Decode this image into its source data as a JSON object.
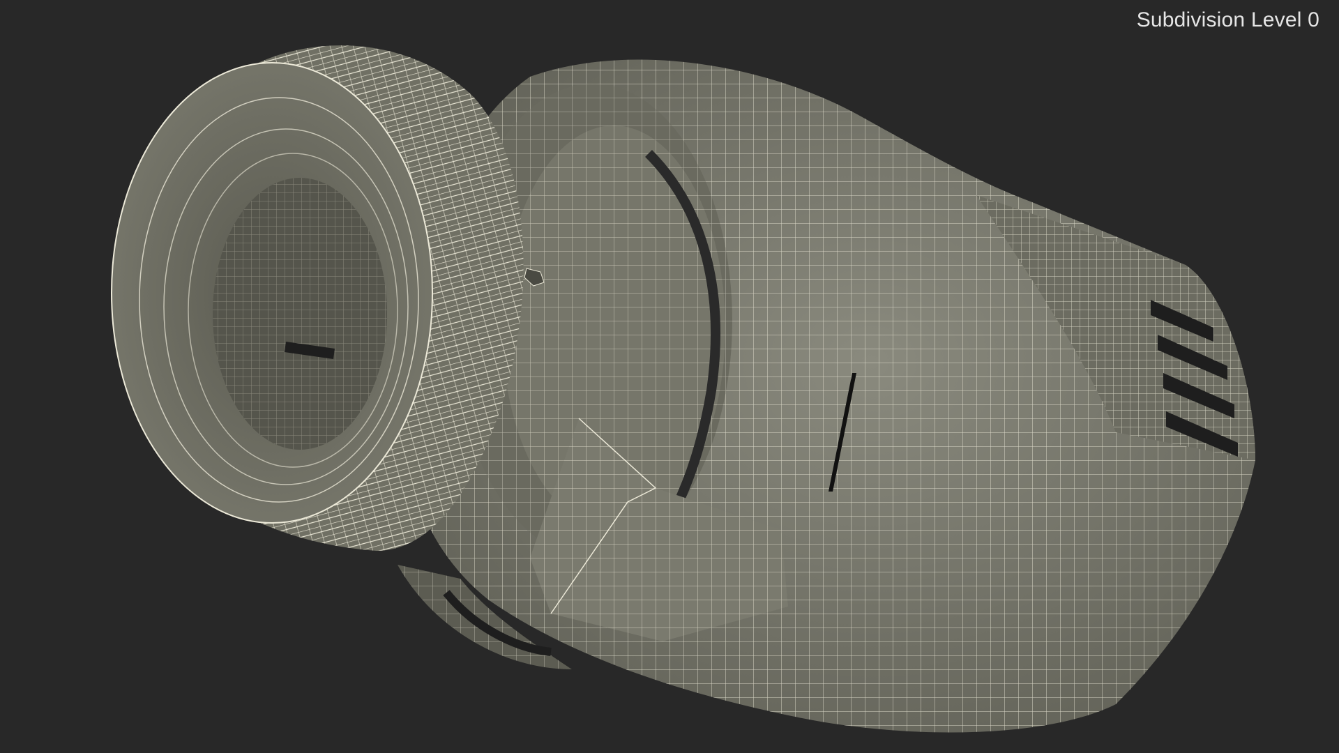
{
  "viewport": {
    "label": "Subdivision Level 0",
    "background_color": "#282828",
    "mesh_fill_color": "#7d7d72",
    "wire_color": "#f2f0e2"
  },
  "model": {
    "icon": "thermostatic-radiator-valve-head-wireframe"
  }
}
